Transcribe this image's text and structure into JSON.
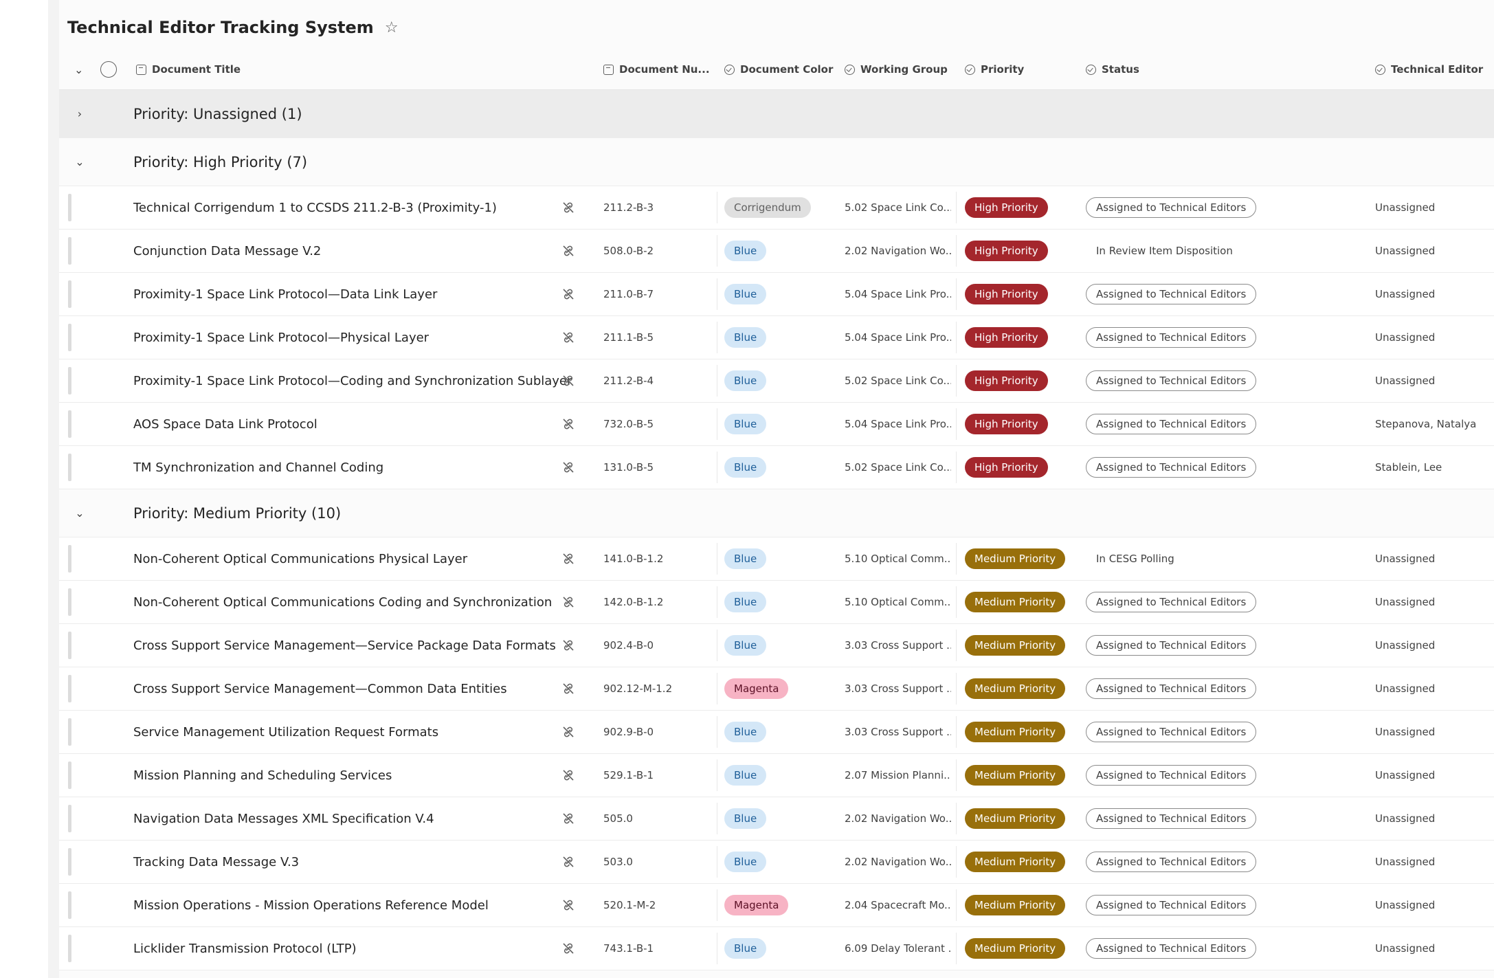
{
  "page": {
    "title": "Technical Editor Tracking System"
  },
  "columns": {
    "document_title": "Document Title",
    "document_number": "Document Nu...",
    "document_color": "Document Color",
    "working_group": "Working Group",
    "priority": "Priority",
    "status": "Status",
    "technical_editor": "Technical Editor"
  },
  "groups": [
    {
      "label": "Priority: Unassigned (1)",
      "collapsed": true,
      "rows": []
    },
    {
      "label": "Priority: High Priority (7)",
      "collapsed": false,
      "rows": [
        {
          "title": "Technical Corrigendum 1 to CCSDS 211.2-B-3 (Proximity-1)",
          "number": "211.2-B-3",
          "color": "Corrigendum",
          "wg": "5.02 Space Link Co...",
          "priority": "High Priority",
          "status": "Assigned to Technical Editors",
          "status_outlined": true,
          "editor": "Unassigned"
        },
        {
          "title": "Conjunction Data Message V.2",
          "number": "508.0-B-2",
          "color": "Blue",
          "wg": "2.02 Navigation Wo...",
          "priority": "High Priority",
          "status": "In Review Item Disposition",
          "status_outlined": false,
          "editor": "Unassigned"
        },
        {
          "title": "Proximity-1 Space Link Protocol—Data Link Layer",
          "number": "211.0-B-7",
          "color": "Blue",
          "wg": "5.04 Space Link Pro...",
          "priority": "High Priority",
          "status": "Assigned to Technical Editors",
          "status_outlined": true,
          "editor": "Unassigned"
        },
        {
          "title": "Proximity-1 Space Link Protocol—Physical Layer",
          "number": "211.1-B-5",
          "color": "Blue",
          "wg": "5.04 Space Link Pro...",
          "priority": "High Priority",
          "status": "Assigned to Technical Editors",
          "status_outlined": true,
          "editor": "Unassigned"
        },
        {
          "title": "Proximity-1 Space Link Protocol—Coding and Synchronization Sublayer",
          "number": "211.2-B-4",
          "color": "Blue",
          "wg": "5.02 Space Link Co...",
          "priority": "High Priority",
          "status": "Assigned to Technical Editors",
          "status_outlined": true,
          "editor": "Unassigned"
        },
        {
          "title": "AOS Space Data Link Protocol",
          "number": "732.0-B-5",
          "color": "Blue",
          "wg": "5.04 Space Link Pro...",
          "priority": "High Priority",
          "status": "Assigned to Technical Editors",
          "status_outlined": true,
          "editor": "Stepanova, Natalya"
        },
        {
          "title": "TM Synchronization and Channel Coding",
          "number": "131.0-B-5",
          "color": "Blue",
          "wg": "5.02 Space Link Co...",
          "priority": "High Priority",
          "status": "Assigned to Technical Editors",
          "status_outlined": true,
          "editor": "Stablein, Lee"
        }
      ]
    },
    {
      "label": "Priority: Medium Priority (10)",
      "collapsed": false,
      "rows": [
        {
          "title": "Non-Coherent Optical Communications Physical Layer",
          "number": "141.0-B-1.2",
          "color": "Blue",
          "wg": "5.10 Optical Comm...",
          "priority": "Medium Priority",
          "status": "In CESG Polling",
          "status_outlined": false,
          "editor": "Unassigned"
        },
        {
          "title": "Non-Coherent Optical Communications Coding and Synchronization",
          "number": "142.0-B-1.2",
          "color": "Blue",
          "wg": "5.10 Optical Comm...",
          "priority": "Medium Priority",
          "status": "Assigned to Technical Editors",
          "status_outlined": true,
          "editor": "Unassigned"
        },
        {
          "title": "Cross Support Service Management—Service Package Data Formats",
          "number": "902.4-B-0",
          "color": "Blue",
          "wg": "3.03 Cross Support ...",
          "priority": "Medium Priority",
          "status": "Assigned to Technical Editors",
          "status_outlined": true,
          "editor": "Unassigned"
        },
        {
          "title": "Cross Support Service Management—Common Data Entities",
          "number": "902.12-M-1.2",
          "color": "Magenta",
          "wg": "3.03 Cross Support ...",
          "priority": "Medium Priority",
          "status": "Assigned to Technical Editors",
          "status_outlined": true,
          "editor": "Unassigned"
        },
        {
          "title": "Service Management Utilization Request Formats",
          "number": "902.9-B-0",
          "color": "Blue",
          "wg": "3.03 Cross Support ...",
          "priority": "Medium Priority",
          "status": "Assigned to Technical Editors",
          "status_outlined": true,
          "editor": "Unassigned"
        },
        {
          "title": "Mission Planning and Scheduling Services",
          "number": "529.1-B-1",
          "color": "Blue",
          "wg": "2.07 Mission Planni...",
          "priority": "Medium Priority",
          "status": "Assigned to Technical Editors",
          "status_outlined": true,
          "editor": "Unassigned"
        },
        {
          "title": "Navigation Data Messages XML Specification V.4",
          "number": "505.0",
          "color": "Blue",
          "wg": "2.02 Navigation Wo...",
          "priority": "Medium Priority",
          "status": "Assigned to Technical Editors",
          "status_outlined": true,
          "editor": "Unassigned"
        },
        {
          "title": "Tracking Data Message V.3",
          "number": "503.0",
          "color": "Blue",
          "wg": "2.02 Navigation Wo...",
          "priority": "Medium Priority",
          "status": "Assigned to Technical Editors",
          "status_outlined": true,
          "editor": "Unassigned"
        },
        {
          "title": "Mission Operations - Mission Operations Reference Model",
          "number": "520.1-M-2",
          "color": "Magenta",
          "wg": "2.04 Spacecraft Mo...",
          "priority": "Medium Priority",
          "status": "Assigned to Technical Editors",
          "status_outlined": true,
          "editor": "Unassigned"
        },
        {
          "title": "Licklider Transmission Protocol (LTP)",
          "number": "743.1-B-1",
          "color": "Blue",
          "wg": "6.09 Delay Tolerant ...",
          "priority": "Medium Priority",
          "status": "Assigned to Technical Editors",
          "status_outlined": true,
          "editor": "Unassigned"
        }
      ]
    }
  ],
  "icons": {
    "collapse_all": "chevron-down-icon",
    "expand": "chevron-right-icon",
    "collapse": "chevron-down-icon",
    "favorite": "star-icon",
    "row_action": "unlink-icon"
  },
  "colors": {
    "high_priority": "#a4262c",
    "medium_priority": "#986f0b",
    "blue_tag": "#d4e7f7",
    "magenta_tag": "#f7b3c4",
    "corrigendum_tag": "#e0e0e0"
  }
}
